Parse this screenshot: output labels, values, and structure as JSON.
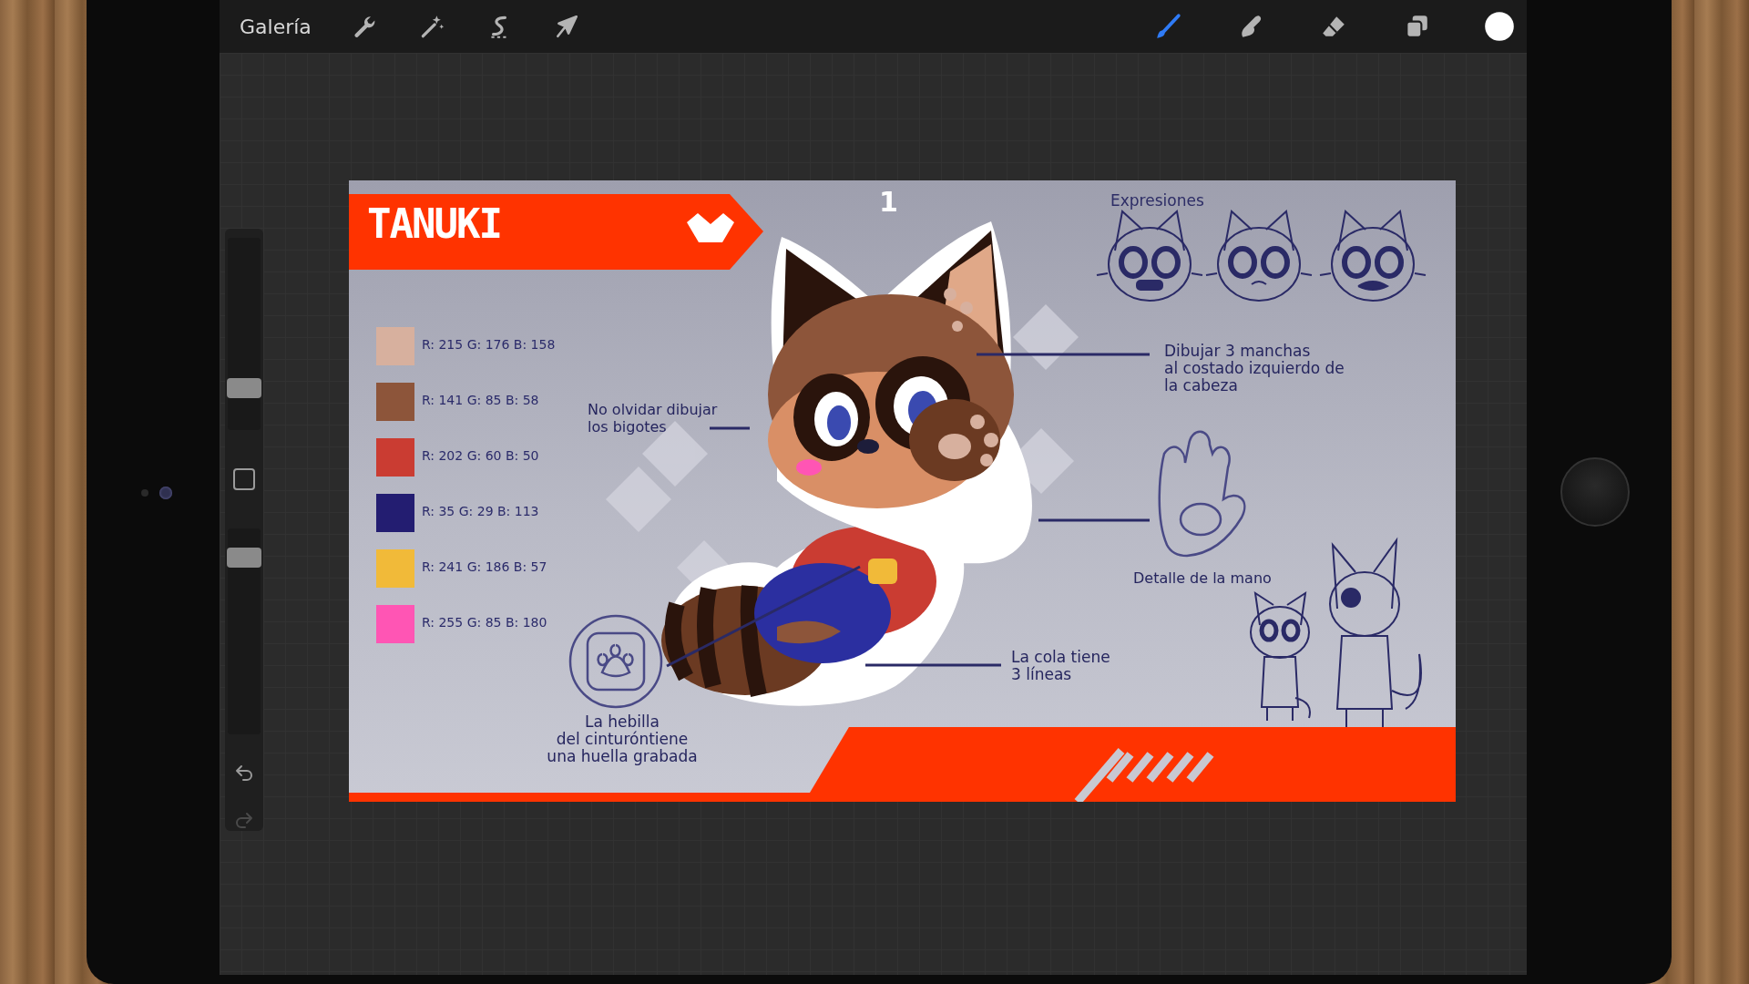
{
  "toolbar": {
    "gallery": "Galería",
    "left_tools": [
      {
        "kind": "wrench"
      },
      {
        "kind": "wand"
      },
      {
        "kind": "selection"
      },
      {
        "kind": "transform"
      }
    ],
    "right_tools": [
      {
        "kind": "brush",
        "selected": true
      },
      {
        "kind": "smudge",
        "selected": false
      },
      {
        "kind": "eraser",
        "selected": false
      },
      {
        "kind": "layers"
      },
      {
        "kind": "color"
      }
    ]
  },
  "sidebar": {
    "sliders": [
      {
        "kind": "size",
        "level": 0.2
      },
      {
        "kind": "opacity",
        "level": 0.9
      }
    ]
  },
  "canvas": {
    "title": "TANUKI",
    "page_number": "1",
    "expressions_label": "Expresiones",
    "swatches": [
      {
        "color": "#d7b09e",
        "label": "R: 215 G: 176 B: 158"
      },
      {
        "color": "#8d553a",
        "label": "R: 141 G: 85 B: 58"
      },
      {
        "color": "#ca3c32",
        "label": "R: 202 G: 60 B: 50"
      },
      {
        "color": "#231d71",
        "label": "R: 35 G: 29 B: 113"
      },
      {
        "color": "#f1ba39",
        "label": "R: 241 G: 186 B: 57"
      },
      {
        "color": "#ff55b4",
        "label": "R: 255 G: 85 B: 180"
      }
    ],
    "notes": [
      {
        "lines": [
          "No olvidar dibujar",
          "los bigotes"
        ]
      },
      {
        "lines": [
          "Dibujar 3 manchas",
          "al costado izquierdo de",
          "la cabeza"
        ]
      },
      {
        "lines": [
          "Detalle de la mano"
        ]
      },
      {
        "lines": [
          "La cola tiene",
          "3 líneas"
        ]
      },
      {
        "lines": [
          "La hebilla",
          "del cinturóntiene",
          "una huella grabada"
        ]
      }
    ]
  }
}
